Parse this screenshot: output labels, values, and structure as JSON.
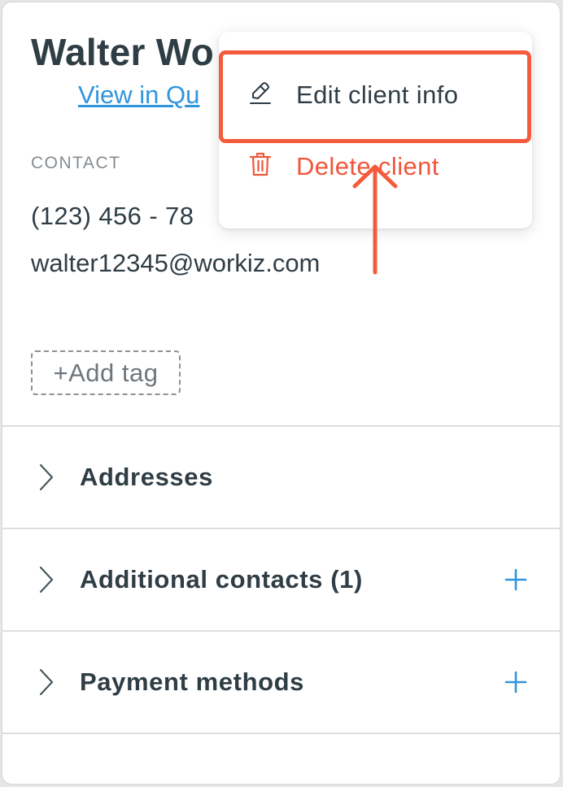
{
  "client": {
    "name": "Walter Wo",
    "view_link": "View in Qu"
  },
  "contact": {
    "section_label": "CONTACT",
    "phone": "(123) 456 - 78",
    "email": "walter12345@workiz.com"
  },
  "tags": {
    "add_label": "+Add tag"
  },
  "sections": [
    {
      "label": "Addresses",
      "has_add": false
    },
    {
      "label": "Additional contacts (1)",
      "has_add": true
    },
    {
      "label": "Payment methods",
      "has_add": true
    }
  ],
  "menu": {
    "edit_label": "Edit client info",
    "delete_label": "Delete client"
  },
  "colors": {
    "accent": "#2f95dc",
    "danger": "#f0563b",
    "highlight": "#f45b3c",
    "text": "#2f3d45"
  },
  "icons": {
    "edit": "pencil-icon",
    "delete": "trash-icon",
    "chevron": "chevron-right-icon",
    "add": "plus-icon"
  }
}
